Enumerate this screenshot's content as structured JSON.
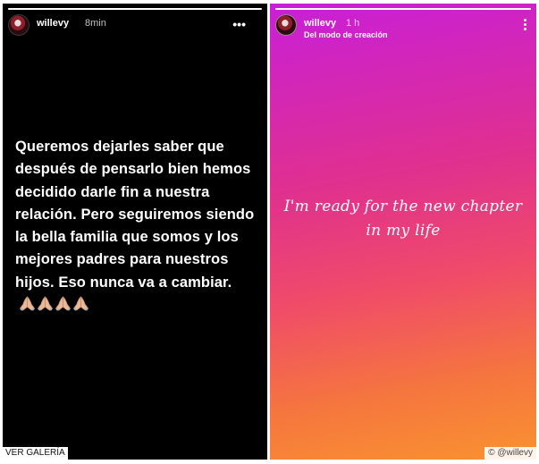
{
  "left_story": {
    "progress": 1.0,
    "username": "willevy",
    "time": "8min",
    "more_icon": "ellipsis-horizontal-icon",
    "text": "Queremos dejarles saber que después de pensarlo bien hemos decidido darle fin a nuestra relación. Pero seguiremos siendo la bella familia que somos y los mejores padres para nuestros hijos. Eso nunca va a cambiar.",
    "emoji": "🙏🏼🙏🏼🙏🏼🙏🏼",
    "emoji_icon": "folded-hands-icon",
    "emoji_count": 4,
    "background": "#000000"
  },
  "right_story": {
    "progress": 1.0,
    "username": "willevy",
    "time": "1 h",
    "subtitle": "Del modo de creación",
    "more_icon": "ellipsis-vertical-icon",
    "text_line1": "I'm ready for the new chapter",
    "text_line2": "in my life",
    "gradient": [
      "#c81fd8",
      "#e0308f",
      "#f04a6a",
      "#f5763e",
      "#f99230"
    ]
  },
  "watermarks": {
    "source": "VER GALERÍA",
    "handle": "© @willevy"
  }
}
